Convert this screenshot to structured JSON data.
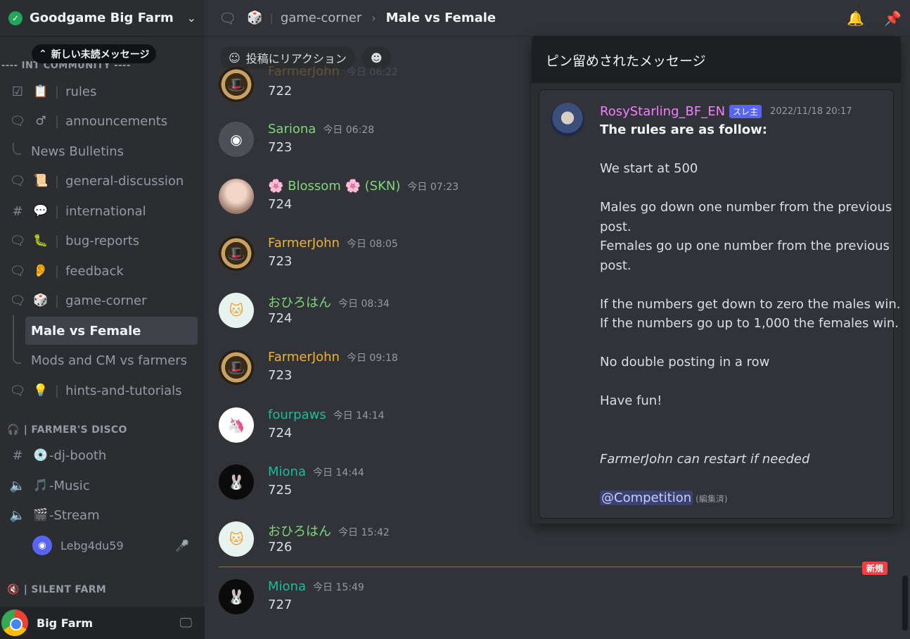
{
  "server": {
    "name": "Goodgame Big Farm"
  },
  "unread_pill": "新しい未読メッセージ",
  "category_cut": "---- INT COMMUNITY ----",
  "channels": [
    {
      "emoji": "📋",
      "name": "rules"
    },
    {
      "emoji": "♂",
      "name": "announcements"
    },
    {
      "emoji": "📜",
      "name": "general-discussion"
    },
    {
      "emoji": "💬",
      "name": "international"
    },
    {
      "emoji": "🐛",
      "name": "bug-reports"
    },
    {
      "emoji": "👂",
      "name": "feedback"
    },
    {
      "emoji": "🎲",
      "name": "game-corner"
    },
    {
      "emoji": "💡",
      "name": "hints-and-tutorials"
    }
  ],
  "threads": {
    "news": "News Bulletins",
    "male_vs_female": "Male vs Female",
    "mods": "Mods and CM vs farmers"
  },
  "categories": {
    "disco": "| FARMER'S DISCO",
    "silent": "| SILENT FARM"
  },
  "voice": [
    {
      "emoji": "💿",
      "name": "-dj-booth"
    },
    {
      "emoji": "🎵",
      "name": "-Music"
    },
    {
      "emoji": "🎬",
      "name": "-Stream"
    }
  ],
  "voice_user": "Lebg4du59",
  "user_panel": {
    "name": "Big Farm"
  },
  "topbar": {
    "emoji": "🎲",
    "parent": "game-corner",
    "title": "Male vs Female"
  },
  "reaction_bar": {
    "react_label": "投稿にリアクション"
  },
  "messages": [
    {
      "author": "FarmerJohn",
      "time": "今日 06:22",
      "text": "722",
      "color": "#f0b232",
      "avatar": "farmer"
    },
    {
      "author": "Sariona",
      "time": "今日 06:28",
      "text": "723",
      "color": "#7dd87d",
      "avatar": "discord"
    },
    {
      "author": "🌸 Blossom 🌸 (SKN)",
      "time": "今日 07:23",
      "text": "724",
      "color": "#7dd87d",
      "avatar": "blossom"
    },
    {
      "author": "FarmerJohn",
      "time": "今日 08:05",
      "text": "723",
      "color": "#f0b232",
      "avatar": "farmer"
    },
    {
      "author": "おひろはん",
      "time": "今日 08:34",
      "text": "724",
      "color": "#7dd87d",
      "avatar": "cat"
    },
    {
      "author": "FarmerJohn",
      "time": "今日 09:18",
      "text": "723",
      "color": "#f0b232",
      "avatar": "farmer"
    },
    {
      "author": "fourpaws",
      "time": "今日 14:14",
      "text": "724",
      "color": "#1abc9c",
      "avatar": "unicorn"
    },
    {
      "author": "Miona",
      "time": "今日 14:44",
      "text": "725",
      "color": "#1abc9c",
      "avatar": "miona"
    },
    {
      "author": "おひろはん",
      "time": "今日 15:42",
      "text": "726",
      "color": "#7dd87d",
      "avatar": "cat"
    },
    {
      "author": "Miona",
      "time": "今日 15:49",
      "text": "727",
      "color": "#1abc9c",
      "avatar": "miona"
    }
  ],
  "new_badge": "新規",
  "pins": {
    "title": "ピン留めされたメッセージ",
    "author": "RosyStarling_BF_EN",
    "tag": "スレ主",
    "time": "2022/11/18 20:17",
    "lines": [
      "The rules are as follow:",
      "We start at 500",
      "Males go down one number from the previous",
      "post.",
      "Females go up one number from the previous",
      "post.",
      "If the numbers get down to zero the males win.",
      "If the numbers go up to 1,000 the females win.",
      "No double posting in a row",
      "Have fun!",
      "FarmerJohn can restart if needed"
    ],
    "mention": "@Competition",
    "edited": "(編集済)"
  }
}
